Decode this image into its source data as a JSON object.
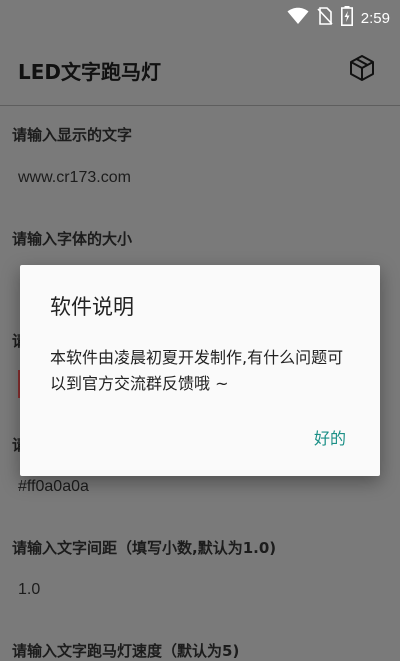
{
  "status_bar": {
    "time": "2:59",
    "icons": [
      "wifi-icon",
      "no-sim-icon",
      "battery-charging-icon"
    ]
  },
  "app_bar": {
    "title": "LED文字跑马灯",
    "action_icon": "cube-icon"
  },
  "form": {
    "text_label": "请输入显示的文字",
    "text_value": "www.cr173.com",
    "size_label": "请输入字体的大小",
    "color_label_partial": "请",
    "bg_label_partial": "请",
    "bg_value": "#ff0a0a0a",
    "spacing_label": "请输入文字间距（填写小数,默认为1.0)",
    "spacing_value": "1.0",
    "speed_label": "请输入文字跑马灯速度（默认为5)"
  },
  "dialog": {
    "title": "软件说明",
    "body": "本软件由凌晨初夏开发制作,有什么问题可以到官方交流群反馈哦 ~",
    "ok_label": "好的"
  },
  "colors": {
    "accent": "#1a8f86",
    "scrim_background": "#7a7a7a",
    "dialog_background": "#fafafa"
  }
}
